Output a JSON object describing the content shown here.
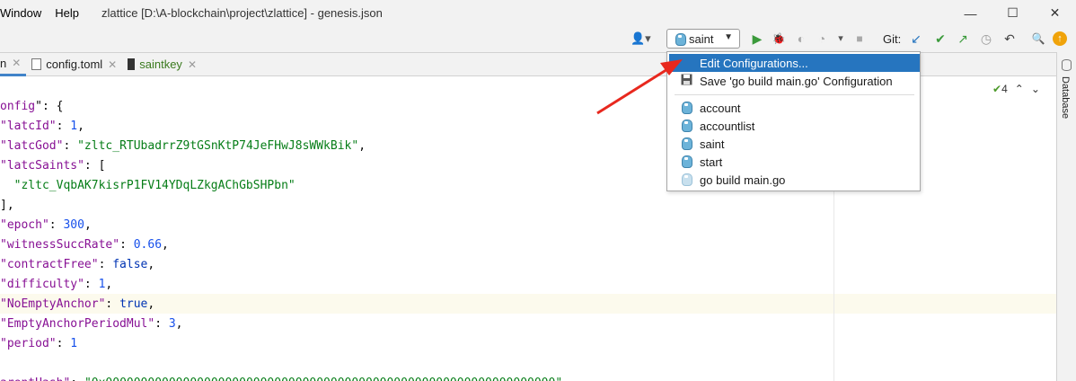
{
  "titlebar": {
    "menus": [
      "Window",
      "Help"
    ],
    "title": "zlattice [D:\\A-blockchain\\project\\zlattice] - genesis.json",
    "minimize": "—",
    "maximize": "☐",
    "close": "✕"
  },
  "toolbar": {
    "user_icon": "👤▾",
    "run_config": "saint",
    "git_label": "Git:",
    "icons": {
      "run": "▶",
      "debug": "🐞",
      "coverage": "◐",
      "profile": "◔",
      "more": "▾",
      "stop": "■",
      "git_update": "↙",
      "git_commit": "✔",
      "git_push": "↗",
      "history": "◷",
      "rollback": "↶",
      "search": "🔍",
      "update": "↑"
    }
  },
  "tabs": [
    {
      "label": "n",
      "active": true
    },
    {
      "label": "config.toml"
    },
    {
      "label": "saintkey"
    }
  ],
  "sidebar_right": {
    "label": "Database"
  },
  "editor": {
    "inspections_count": "4",
    "lines": [
      [
        {
          "c": "k",
          "t": "onfig"
        },
        {
          "c": "p",
          "t": "\": {"
        }
      ],
      [
        {
          "c": "k",
          "t": "\"latcId\""
        },
        {
          "c": "p",
          "t": ": "
        },
        {
          "c": "n",
          "t": "1"
        },
        {
          "c": "p",
          "t": ","
        }
      ],
      [
        {
          "c": "k",
          "t": "\"latcGod\""
        },
        {
          "c": "p",
          "t": ": "
        },
        {
          "c": "s",
          "t": "\"zltc_RTUbadrrZ9tGSnKtP74JeFHwJ8sWWkBik\""
        },
        {
          "c": "p",
          "t": ","
        }
      ],
      [
        {
          "c": "k",
          "t": "\"latcSaints\""
        },
        {
          "c": "p",
          "t": ": ["
        }
      ],
      [
        {
          "c": "p",
          "t": "  "
        },
        {
          "c": "s",
          "t": "\"zltc_VqbAK7kisrP1FV14YDqLZkgAChGbSHPbn\""
        }
      ],
      [
        {
          "c": "p",
          "t": "],"
        }
      ],
      [
        {
          "c": "k",
          "t": "\"epoch\""
        },
        {
          "c": "p",
          "t": ": "
        },
        {
          "c": "n",
          "t": "300"
        },
        {
          "c": "p",
          "t": ","
        }
      ],
      [
        {
          "c": "k",
          "t": "\"witnessSuccRate\""
        },
        {
          "c": "p",
          "t": ": "
        },
        {
          "c": "n",
          "t": "0.66"
        },
        {
          "c": "p",
          "t": ","
        }
      ],
      [
        {
          "c": "k",
          "t": "\"contractFree\""
        },
        {
          "c": "p",
          "t": ": "
        },
        {
          "c": "kw",
          "t": "false"
        },
        {
          "c": "p",
          "t": ","
        }
      ],
      [
        {
          "c": "k",
          "t": "\"difficulty\""
        },
        {
          "c": "p",
          "t": ": "
        },
        {
          "c": "n",
          "t": "1"
        },
        {
          "c": "p",
          "t": ","
        }
      ],
      [
        {
          "c": "k",
          "t": "\"NoEmptyAnchor\""
        },
        {
          "c": "p",
          "t": ": "
        },
        {
          "c": "kw",
          "t": "true"
        },
        {
          "c": "p",
          "t": ","
        }
      ],
      [
        {
          "c": "k",
          "t": "\"EmptyAnchorPeriodMul\""
        },
        {
          "c": "p",
          "t": ": "
        },
        {
          "c": "n",
          "t": "3"
        },
        {
          "c": "p",
          "t": ","
        }
      ],
      [
        {
          "c": "k",
          "t": "\"period\""
        },
        {
          "c": "p",
          "t": ": "
        },
        {
          "c": "n",
          "t": "1"
        }
      ],
      [
        {
          "c": "p",
          "t": " "
        }
      ],
      [
        {
          "c": "k",
          "t": "arentHash\""
        },
        {
          "c": "p",
          "t": ": "
        },
        {
          "c": "s",
          "t": "\"0x0000000000000000000000000000000000000000000000000000000000000000\""
        }
      ]
    ]
  },
  "dropdown": {
    "items": [
      {
        "label": "Edit Configurations...",
        "icon": "gopher-icon",
        "selected": true
      },
      {
        "label": "Save 'go build main.go' Configuration",
        "icon": "save-icon"
      },
      {
        "label": "account",
        "icon": "gopher-icon"
      },
      {
        "label": "accountlist",
        "icon": "gopher-icon"
      },
      {
        "label": "saint",
        "icon": "gopher-icon"
      },
      {
        "label": "start",
        "icon": "gopher-icon"
      },
      {
        "label": "go build main.go",
        "icon": "gopher-icon-faded"
      }
    ]
  },
  "colors": {
    "accent_blue": "#2675bf",
    "annotation_arrow": "#e8281e",
    "json_key": "#871094",
    "json_string": "#067d17",
    "json_number": "#1750eb",
    "json_keyword": "#0033b3"
  }
}
